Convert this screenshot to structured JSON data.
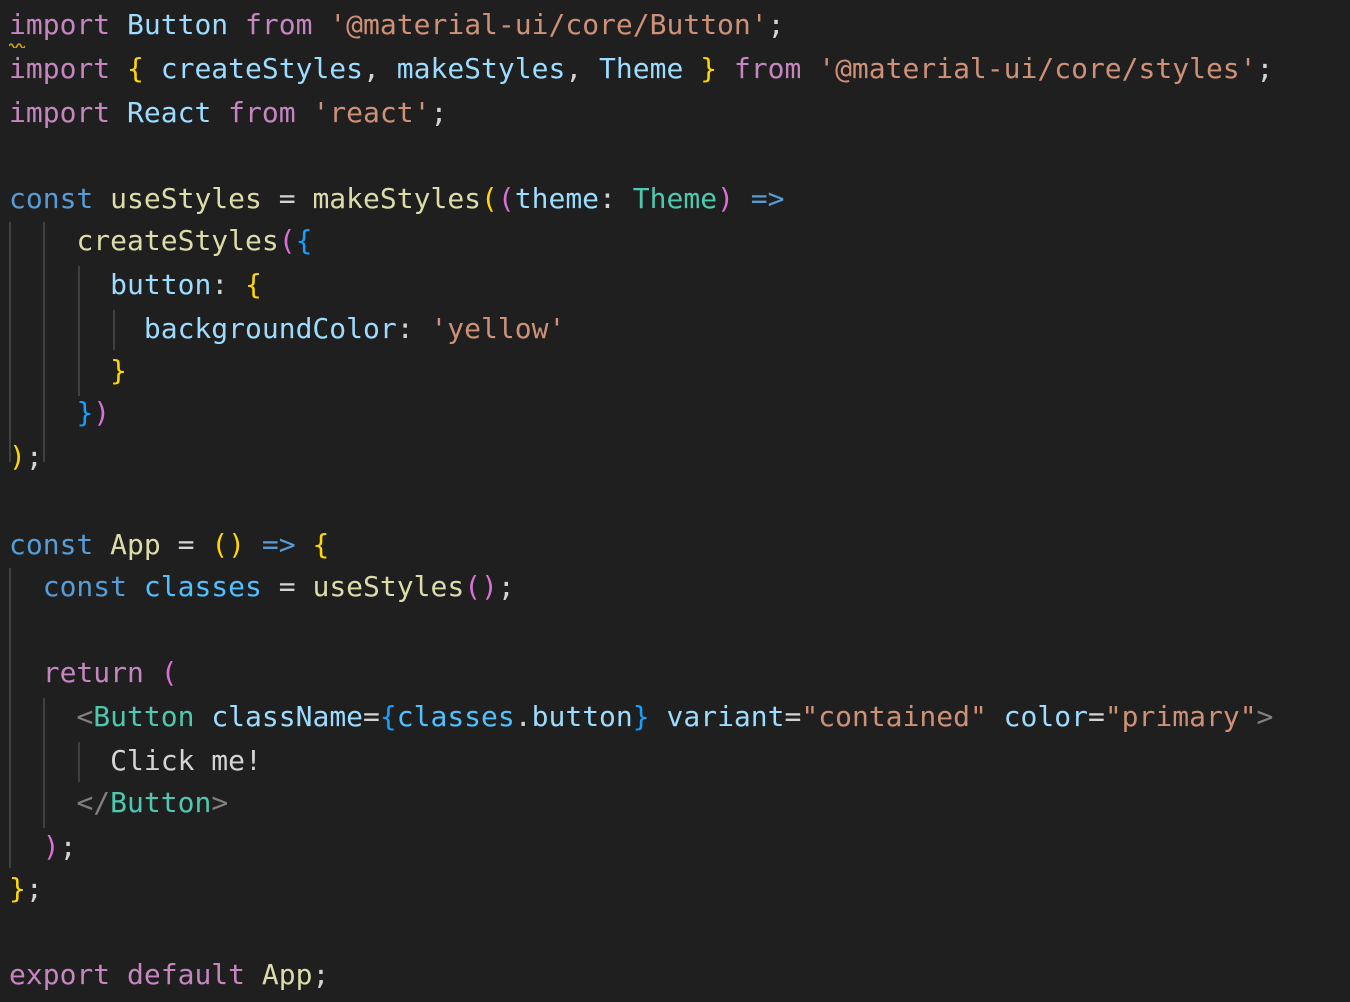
{
  "colors": {
    "background": "#1f1f1f",
    "keyword_purple": "#c586c0",
    "keyword_blue": "#569cd6",
    "identifier": "#9cdcfe",
    "function": "#dcdcaa",
    "type": "#4ec9b0",
    "string": "#ce9178",
    "brace_gold": "#ffd700",
    "brace_violet": "#da70d6",
    "brace_blue": "#179fff",
    "plain": "#d4d4d4",
    "tag_bracket": "#808080",
    "indent_guide": "#404040",
    "warning_squiggle": "#cca700"
  },
  "editor": {
    "language": "TypeScript React",
    "lines": [
      [
        [
          "import",
          "#c586c0"
        ],
        [
          " ",
          ""
        ],
        [
          "Button",
          "#9cdcfe"
        ],
        [
          " ",
          ""
        ],
        [
          "from",
          "#c586c0"
        ],
        [
          " ",
          ""
        ],
        [
          "'@material-ui/core/Button'",
          "#ce9178"
        ],
        [
          ";",
          "#d4d4d4"
        ]
      ],
      [
        [
          "import",
          "#c586c0"
        ],
        [
          " ",
          ""
        ],
        [
          "{",
          "#ffd700"
        ],
        [
          " ",
          ""
        ],
        [
          "createStyles",
          "#9cdcfe"
        ],
        [
          ", ",
          "#d4d4d4"
        ],
        [
          "makeStyles",
          "#9cdcfe"
        ],
        [
          ", ",
          "#d4d4d4"
        ],
        [
          "Theme",
          "#9cdcfe"
        ],
        [
          " ",
          ""
        ],
        [
          "}",
          "#ffd700"
        ],
        [
          " ",
          ""
        ],
        [
          "from",
          "#c586c0"
        ],
        [
          " ",
          ""
        ],
        [
          "'@material-ui/core/styles'",
          "#ce9178"
        ],
        [
          ";",
          "#d4d4d4"
        ]
      ],
      [
        [
          "import",
          "#c586c0"
        ],
        [
          " ",
          ""
        ],
        [
          "React",
          "#9cdcfe"
        ],
        [
          " ",
          ""
        ],
        [
          "from",
          "#c586c0"
        ],
        [
          " ",
          ""
        ],
        [
          "'react'",
          "#ce9178"
        ],
        [
          ";",
          "#d4d4d4"
        ]
      ],
      [],
      [
        [
          "const",
          "#569cd6"
        ],
        [
          " ",
          ""
        ],
        [
          "useStyles",
          "#dcdcaa"
        ],
        [
          " = ",
          "#d4d4d4"
        ],
        [
          "makeStyles",
          "#dcdcaa"
        ],
        [
          "(",
          "#ffd700"
        ],
        [
          "(",
          "#da70d6"
        ],
        [
          "theme",
          "#9cdcfe"
        ],
        [
          ": ",
          "#d4d4d4"
        ],
        [
          "Theme",
          "#4ec9b0"
        ],
        [
          ")",
          "#da70d6"
        ],
        [
          " ",
          ""
        ],
        [
          "=>",
          "#569cd6"
        ]
      ],
      [
        [
          "    ",
          ""
        ],
        [
          "createStyles",
          "#dcdcaa"
        ],
        [
          "(",
          "#da70d6"
        ],
        [
          "{",
          "#179fff"
        ]
      ],
      [
        [
          "      ",
          ""
        ],
        [
          "button",
          "#9cdcfe"
        ],
        [
          ": ",
          "#d4d4d4"
        ],
        [
          "{",
          "#ffd700"
        ]
      ],
      [
        [
          "        ",
          ""
        ],
        [
          "backgroundColor",
          "#9cdcfe"
        ],
        [
          ": ",
          "#d4d4d4"
        ],
        [
          "'yellow'",
          "#ce9178"
        ]
      ],
      [
        [
          "      ",
          ""
        ],
        [
          "}",
          "#ffd700"
        ]
      ],
      [
        [
          "    ",
          ""
        ],
        [
          "}",
          "#179fff"
        ],
        [
          ")",
          "#da70d6"
        ]
      ],
      [
        [
          ")",
          "#ffd700"
        ],
        [
          ";",
          "#d4d4d4"
        ]
      ],
      [],
      [
        [
          "const",
          "#569cd6"
        ],
        [
          " ",
          ""
        ],
        [
          "App",
          "#dcdcaa"
        ],
        [
          " = ",
          "#d4d4d4"
        ],
        [
          "()",
          "#ffd700"
        ],
        [
          " ",
          ""
        ],
        [
          "=>",
          "#569cd6"
        ],
        [
          " ",
          ""
        ],
        [
          "{",
          "#ffd700"
        ]
      ],
      [
        [
          "  ",
          ""
        ],
        [
          "const",
          "#569cd6"
        ],
        [
          " ",
          ""
        ],
        [
          "classes",
          "#4fc1ff"
        ],
        [
          " = ",
          "#d4d4d4"
        ],
        [
          "useStyles",
          "#dcdcaa"
        ],
        [
          "()",
          "#da70d6"
        ],
        [
          ";",
          "#d4d4d4"
        ]
      ],
      [],
      [
        [
          "  ",
          ""
        ],
        [
          "return",
          "#c586c0"
        ],
        [
          " ",
          ""
        ],
        [
          "(",
          "#da70d6"
        ]
      ],
      [
        [
          "    ",
          ""
        ],
        [
          "<",
          "#808080"
        ],
        [
          "Button",
          "#4ec9b0"
        ],
        [
          " ",
          ""
        ],
        [
          "className",
          "#9cdcfe"
        ],
        [
          "=",
          "#d4d4d4"
        ],
        [
          "{",
          "#179fff"
        ],
        [
          "classes",
          "#4fc1ff"
        ],
        [
          ".",
          "#d4d4d4"
        ],
        [
          "button",
          "#9cdcfe"
        ],
        [
          "}",
          "#179fff"
        ],
        [
          " ",
          ""
        ],
        [
          "variant",
          "#9cdcfe"
        ],
        [
          "=",
          "#d4d4d4"
        ],
        [
          "\"contained\"",
          "#ce9178"
        ],
        [
          " ",
          ""
        ],
        [
          "color",
          "#9cdcfe"
        ],
        [
          "=",
          "#d4d4d4"
        ],
        [
          "\"primary\"",
          "#ce9178"
        ],
        [
          ">",
          "#808080"
        ]
      ],
      [
        [
          "      ",
          ""
        ],
        [
          "Click me!",
          "#d4d4d4"
        ]
      ],
      [
        [
          "    ",
          ""
        ],
        [
          "</",
          "#808080"
        ],
        [
          "Button",
          "#4ec9b0"
        ],
        [
          ">",
          "#808080"
        ]
      ],
      [
        [
          "  ",
          ""
        ],
        [
          ")",
          "#da70d6"
        ],
        [
          ";",
          "#d4d4d4"
        ]
      ],
      [
        [
          "}",
          "#ffd700"
        ],
        [
          ";",
          "#d4d4d4"
        ]
      ],
      [],
      [
        [
          "export",
          "#c586c0"
        ],
        [
          " ",
          ""
        ],
        [
          "default",
          "#c586c0"
        ],
        [
          " ",
          ""
        ],
        [
          "App",
          "#dcdcaa"
        ],
        [
          ";",
          "#d4d4d4"
        ]
      ]
    ]
  }
}
